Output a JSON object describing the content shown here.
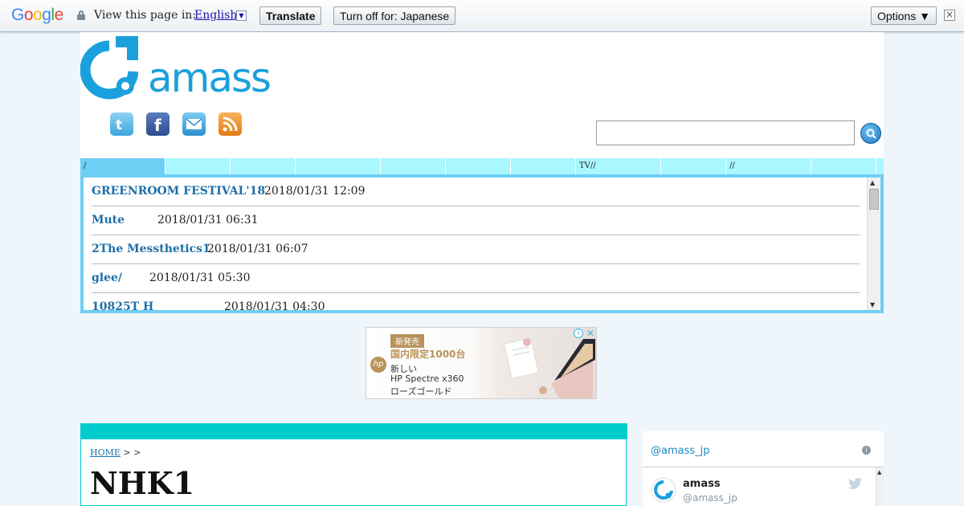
{
  "translate_bar": {
    "logo": "Google",
    "view_label": "View this page in:",
    "language": "English",
    "translate_button": "Translate",
    "turn_off_button": "Turn off for: Japanese",
    "options_button": "Options ▼",
    "close": "×"
  },
  "header": {
    "logo_text": "amass",
    "social_icons": [
      "twitter-icon",
      "facebook-icon",
      "mail-icon",
      "rss-icon"
    ],
    "search": {
      "value": "",
      "button_icon": "search-icon"
    }
  },
  "nav": {
    "items": [
      "/",
      "",
      "",
      "",
      "",
      "",
      "",
      "TV//",
      "",
      "//",
      "",
      ""
    ]
  },
  "news": {
    "items": [
      {
        "title": "GREENROOM FESTIVAL'18",
        "date": "2018/01/31 12:09"
      },
      {
        "title": "Mute",
        "date": "2018/01/31 06:31"
      },
      {
        "title": "2The Messthetics1",
        "date": "2018/01/31 06:07"
      },
      {
        "title": "glee/",
        "date": "2018/01/31 05:30"
      },
      {
        "title": "10825T      H",
        "date": "2018/01/31 04:30"
      }
    ]
  },
  "ad": {
    "badge": "新発売",
    "line1": "国内限定1000台",
    "line2": "新しい",
    "line3": "HP Spectre x360",
    "line4": "ローズゴールド",
    "brand": "hp"
  },
  "article": {
    "breadcrumb_home": "HOME",
    "breadcrumb_sep": " >  >",
    "title": "NHK1"
  },
  "twitter": {
    "handle": "@amass_jp",
    "name": "amass",
    "user": "@amass_jp"
  }
}
